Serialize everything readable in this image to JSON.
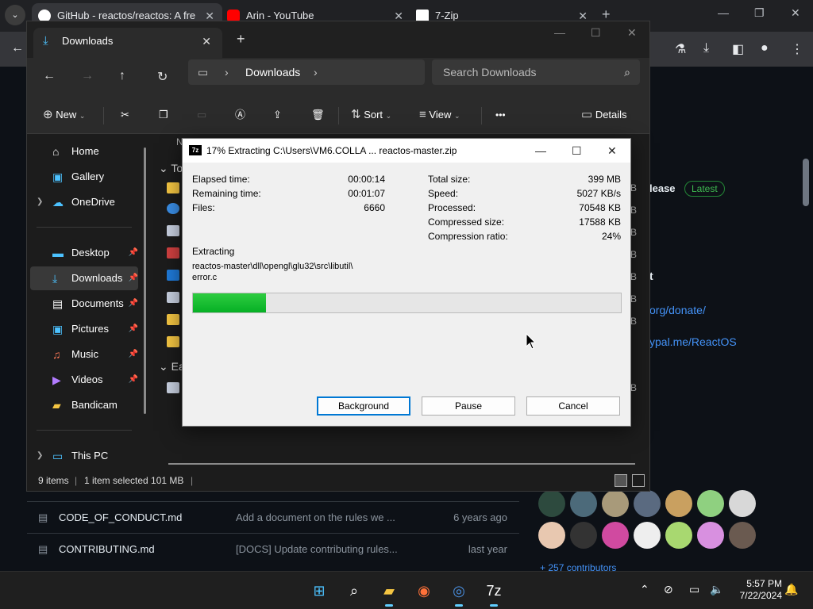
{
  "browser": {
    "tabs": [
      {
        "label": "GitHub - reactos/reactos: A fre",
        "close": "✕"
      },
      {
        "label": "Arin - YouTube",
        "close": "✕"
      },
      {
        "label": "7-Zip",
        "close": "✕"
      }
    ],
    "new_tab": "+",
    "dropdown": "⌄"
  },
  "github": {
    "release_label": "lease",
    "latest_badge": "Latest",
    "sponsor_heading": "t",
    "link1": "org/donate/",
    "link2": "ypal.me/ReactOS",
    "files": [
      {
        "name": "CODE_OF_CONDUCT.md",
        "commit": "Add a document on the rules we ...",
        "date": "6 years ago"
      },
      {
        "name": "CONTRIBUTING.md",
        "commit": "[DOCS] Update contributing rules...",
        "date": "last year"
      }
    ],
    "contributors_link": "+ 257 contributors"
  },
  "explorer": {
    "tab_title": "Downloads",
    "breadcrumb": "Downloads",
    "search_placeholder": "Search Downloads",
    "commands": {
      "new": "New",
      "sort": "Sort",
      "view": "View",
      "more": "•••",
      "details": "Details"
    },
    "nav": {
      "quick": [
        {
          "label": "Home"
        },
        {
          "label": "Gallery"
        },
        {
          "label": "OneDrive"
        }
      ],
      "pinned": [
        {
          "label": "Desktop"
        },
        {
          "label": "Downloads"
        },
        {
          "label": "Documents"
        },
        {
          "label": "Pictures"
        },
        {
          "label": "Music"
        },
        {
          "label": "Videos"
        },
        {
          "label": "Bandicam"
        }
      ],
      "this_pc": "This PC"
    },
    "content": {
      "group_today": "To",
      "group_earlier": "Ea",
      "col_header": "N",
      "size_unit": "B"
    },
    "status": {
      "items": "9 items",
      "selection": "1 item selected  101 MB"
    }
  },
  "sevenzip": {
    "title": "17% Extracting C:\\Users\\VM6.COLLA ... reactos-master.zip",
    "logo": "7z",
    "left": [
      {
        "k": "Elapsed time:",
        "v": "00:00:14"
      },
      {
        "k": "Remaining time:",
        "v": "00:01:07"
      },
      {
        "k": "Files:",
        "v": "6660"
      }
    ],
    "right": [
      {
        "k": "Total size:",
        "v": "399 MB"
      },
      {
        "k": "Speed:",
        "v": "5027 KB/s"
      },
      {
        "k": "Processed:",
        "v": "70548 KB"
      },
      {
        "k": "Compressed size:",
        "v": "17588 KB"
      },
      {
        "k": "Compression ratio:",
        "v": "24%"
      }
    ],
    "action": "Extracting",
    "path_line1": "reactos-master\\dll\\opengl\\glu32\\src\\libutil\\",
    "path_line2": "error.c",
    "progress_percent": 17,
    "buttons": {
      "background": "Background",
      "pause": "Pause",
      "cancel": "Cancel"
    }
  },
  "taskbar": {
    "time": "5:57 PM",
    "date": "7/22/2024"
  },
  "colors": {
    "progress": "#06b025",
    "accent": "#0078d4",
    "github_link": "#4493f8"
  }
}
